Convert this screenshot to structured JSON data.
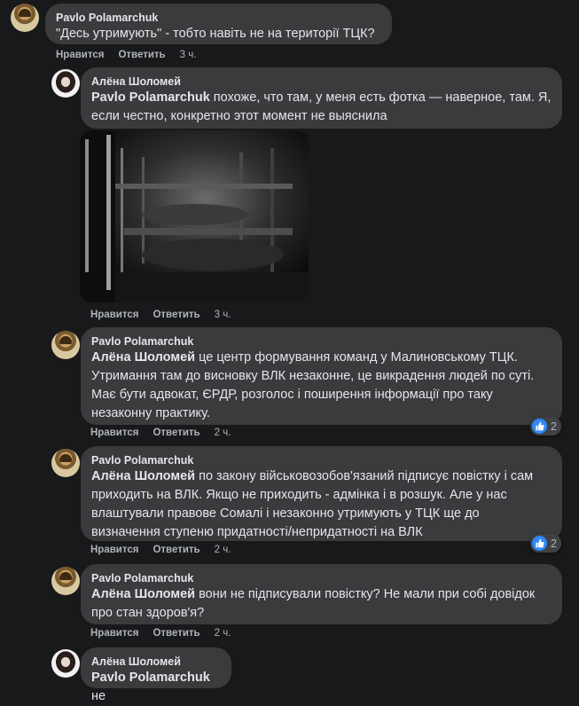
{
  "actions": {
    "like": "Нравится",
    "reply": "Ответить"
  },
  "comments": [
    {
      "author": "Pavlo Polamarchuk",
      "text": "\"Десь утримують\" - тобто навіть не на території ТЦК?",
      "time": "3 ч."
    },
    {
      "author": "Алёна Шоломей",
      "mention": "Pavlo Polamarchuk",
      "text": " похоже, что там, у меня есть фотка — наверное, там. Я, если честно, конкретно этот момент не выяснила",
      "time": "3 ч."
    },
    {
      "author": "Pavlo Polamarchuk",
      "mention": "Алёна Шоломей",
      "text": " це центр формування команд у Малиновському ТЦК. Утримання там до висновку ВЛК незаконне, це викрадення людей по суті. Має бути адвокат, ЄРДР, розголос і поширення інформації про таку незаконну практику.",
      "time": "2 ч.",
      "reactions": "2"
    },
    {
      "author": "Pavlo Polamarchuk",
      "mention": "Алёна Шоломей",
      "text": " по закону військовозобов'язаний підписує повістку і сам приходить на ВЛК. Якщо не приходить - адмінка і в розшук. Але у нас влаштували правове Сомалі і незаконно утримують у ТЦК ще до визначення ступеню придатності/непридатності на ВЛК",
      "time": "2 ч.",
      "reactions": "2"
    },
    {
      "author": "Pavlo Polamarchuk",
      "mention": "Алёна Шоломей",
      "text": " вони не підписували повістку? Не мали при собі довідок про стан здоров'я?",
      "time": "2 ч."
    },
    {
      "author": "Алёна Шоломей",
      "mention": "Pavlo Polamarchuk",
      "text": " не"
    }
  ]
}
